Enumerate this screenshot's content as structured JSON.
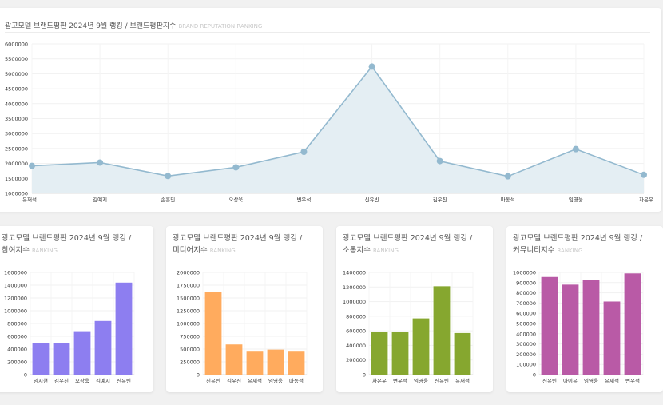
{
  "colors": {
    "line": "#93b9cf",
    "area": "#e4eef3",
    "participation": "#8d7ef0",
    "media": "#ffab5e",
    "communication": "#86a72f",
    "community": "#b95aa6"
  },
  "chart_data": [
    {
      "type": "area",
      "title": "광고모델 브랜드평판 2024년 9월 랭킹 / 브랜드평판지수",
      "subtitle": "BRAND REPUTATION RANKING",
      "categories": [
        "유재석",
        "김예지",
        "손흥민",
        "오상욱",
        "변우석",
        "신유빈",
        "김우진",
        "마동석",
        "임영웅",
        "차은우"
      ],
      "values": [
        1920000,
        2030000,
        1580000,
        1870000,
        2390000,
        5240000,
        2080000,
        1570000,
        2480000,
        1620000
      ],
      "ylim": [
        1000000,
        6000000
      ],
      "yticks": [
        "6000000",
        "5500000",
        "5000000",
        "4500000",
        "4000000",
        "3500000",
        "3000000",
        "2500000",
        "2000000",
        "1500000",
        "1000000"
      ]
    },
    {
      "type": "bar",
      "title_line1": "광고모델 브랜드평판 2024년 9월 랭킹 /",
      "title_line2": "참여지수",
      "subtitle": "RANKING",
      "categories": [
        "임시현",
        "김우진",
        "오상욱",
        "김예지",
        "신유빈"
      ],
      "values": [
        490000,
        490000,
        680000,
        840000,
        1440000
      ],
      "ylim": [
        0,
        1600000
      ],
      "yticks": [
        "1600000",
        "1400000",
        "1200000",
        "1000000",
        "800000",
        "600000",
        "400000",
        "200000",
        "0"
      ]
    },
    {
      "type": "bar",
      "title_line1": "광고모델 브랜드평판 2024년 9월 랭킹 /",
      "title_line2": "미디어지수",
      "subtitle": "RANKING",
      "categories": [
        "신유빈",
        "김우진",
        "유재석",
        "임영웅",
        "마동석"
      ],
      "values": [
        1620000,
        590000,
        450000,
        490000,
        450000
      ],
      "ylim": [
        0,
        2000000
      ],
      "yticks": [
        "2000000",
        "1750000",
        "1500000",
        "1250000",
        "1000000",
        "750000",
        "500000",
        "250000",
        "0"
      ]
    },
    {
      "type": "bar",
      "title_line1": "광고모델 브랜드평판 2024년 9월 랭킹 /",
      "title_line2": "소통지수",
      "subtitle": "RANKING",
      "categories": [
        "차은우",
        "변우석",
        "임영웅",
        "신유빈",
        "유재석"
      ],
      "values": [
        580000,
        590000,
        770000,
        1210000,
        570000
      ],
      "ylim": [
        0,
        1400000
      ],
      "yticks": [
        "1400000",
        "1200000",
        "1000000",
        "800000",
        "600000",
        "400000",
        "200000",
        "0"
      ]
    },
    {
      "type": "bar",
      "title_line1": "광고모델 브랜드평판 2024년 9월 랭킹 /",
      "title_line2": "커뮤니티지수",
      "subtitle": "RANKING",
      "categories": [
        "신유빈",
        "아이유",
        "임영웅",
        "유재석",
        "변우석"
      ],
      "values": [
        955000,
        880000,
        925000,
        715000,
        990000
      ],
      "ylim": [
        0,
        1000000
      ],
      "yticks": [
        "1000000",
        "900000",
        "800000",
        "700000",
        "600000",
        "500000",
        "400000",
        "300000",
        "200000",
        "100000",
        "0"
      ]
    }
  ]
}
